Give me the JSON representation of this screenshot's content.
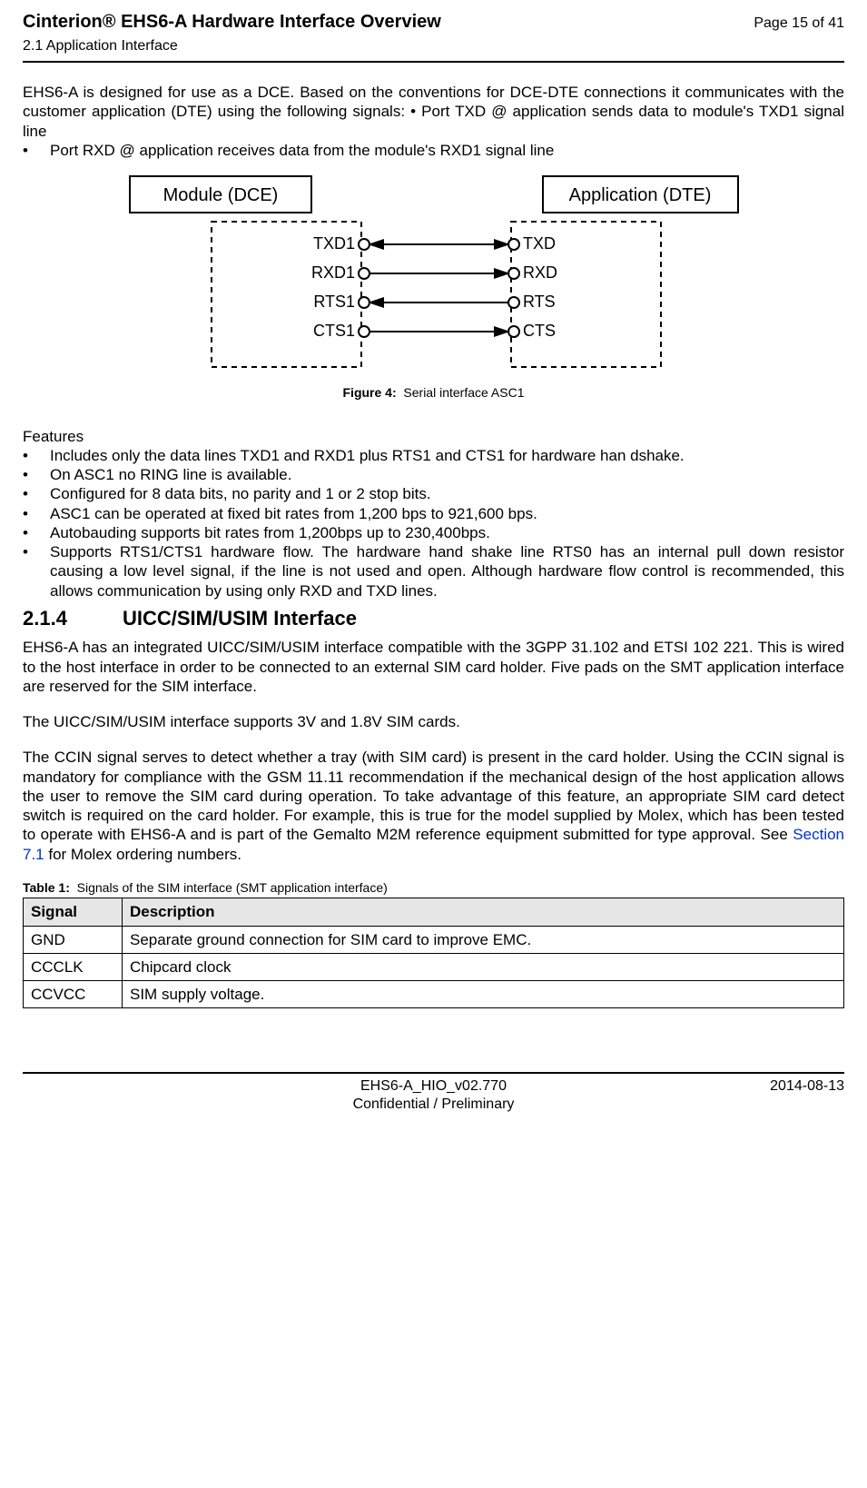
{
  "header": {
    "title": "Cinterion® EHS6-A Hardware Interface Overview",
    "page": "Page 15 of 41",
    "subsection": "2.1 Application Interface"
  },
  "intro": {
    "line1": "EHS6-A is designed for use as a DCE. Based on the conventions for DCE-DTE connections it communicates with the customer application (DTE) using the following signals: •    Port TXD @ application sends data to module's TXD1 signal line",
    "bullet": "Port RXD @ application receives data from the module's RXD1 signal line"
  },
  "figure": {
    "module_label": "Module (DCE)",
    "app_label": "Application (DTE)",
    "left": [
      "TXD1",
      "RXD1",
      "RTS1",
      "CTS1"
    ],
    "right": [
      "TXD",
      "RXD",
      "RTS",
      "CTS"
    ],
    "caption_b": "Figure 4:",
    "caption_t": "Serial interface ASC1"
  },
  "features": {
    "head": "Features",
    "items": [
      "Includes only the data lines TXD1 and RXD1 plus RTS1 and CTS1 for hardware han dshake.",
      "On ASC1 no RING line is available.",
      "Configured for 8 data bits, no parity and 1 or 2 stop bits.",
      "ASC1 can be operated at fixed bit rates from 1,200 bps to 921,600 bps.",
      "Autobauding supports bit rates from 1,200bps up to 230,400bps.",
      "Supports RTS1/CTS1 hardware flow. The hardware hand shake line RTS0 has an internal pull down resistor causing a low level signal, if the line is not used and open. Although hardware flow control is recommended, this allows communication by using only RXD and TXD lines."
    ]
  },
  "section": {
    "num": "2.1.4",
    "title": "UICC/SIM/USIM Interface"
  },
  "p1": "EHS6-A has an integrated UICC/SIM/USIM interface compatible with the 3GPP 31.102 and ETSI 102 221. This is wired to the host interface in order to be connected to an external SIM card holder. Five pads on the SMT application interface are reserved for the SIM interface.",
  "p2": "The UICC/SIM/USIM interface supports 3V and 1.8V SIM cards.",
  "p3a": "The CCIN signal serves to detect whether a tray (with SIM card) is present in the card holder. Using the CCIN signal is mandatory for compliance with the GSM 11.11 recommendation if the mechanical design of the host application allows the user to remove the SIM card during operation. To take advantage of this feature, an appropriate SIM card detect switch is required on the card holder. For example, this is true for the model supplied by Molex, which has been tested to operate with EHS6-A and is part of the Gemalto M2M reference equipment submitted for type approval. See ",
  "p3link": "Section 7.1",
  "p3b": " for Molex ordering numbers.",
  "table": {
    "caption_b": "Table 1:",
    "caption_t": "Signals of the SIM interface (SMT application interface)",
    "h1": "Signal",
    "h2": "Description",
    "rows": [
      {
        "s": "GND",
        "d": "Separate ground connection for SIM card to improve EMC."
      },
      {
        "s": "CCCLK",
        "d": "Chipcard clock"
      },
      {
        "s": "CCVCC",
        "d": "SIM supply voltage."
      }
    ]
  },
  "footer": {
    "center1": "EHS6-A_HIO_v02.770",
    "center2": "Confidential / Preliminary",
    "date": "2014-08-13"
  }
}
